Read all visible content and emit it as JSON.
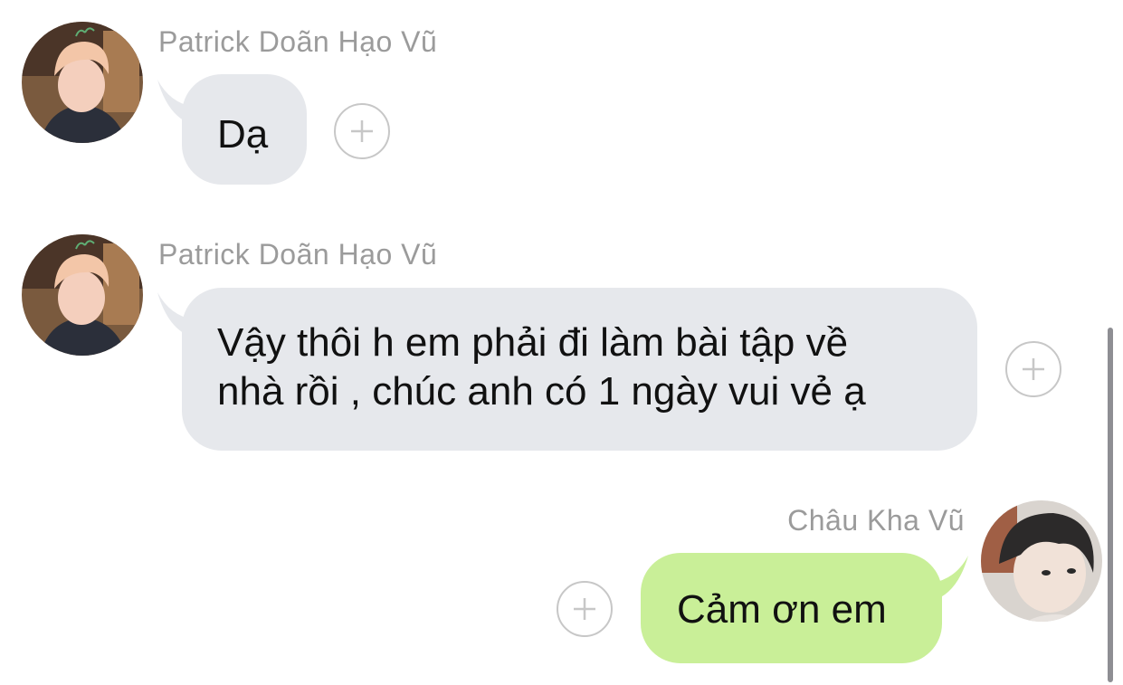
{
  "messages": [
    {
      "sender": "Patrick Doãn Hạo Vũ",
      "text": "Dạ",
      "direction": "incoming"
    },
    {
      "sender": "Patrick Doãn Hạo Vũ",
      "text_line1": "Vậy thôi h em phải đi làm bài tập về",
      "text_line2": "nhà rồi , chúc anh có 1 ngày vui vẻ ạ",
      "direction": "incoming"
    },
    {
      "sender": "Châu Kha Vũ",
      "text": "Cảm ơn em",
      "direction": "outgoing"
    }
  ],
  "colors": {
    "incoming_bubble": "#e6e8ec",
    "outgoing_bubble": "#c9ef98",
    "sender_name": "#9b9b9b",
    "react_button_border": "#c7c7c7"
  },
  "icons": {
    "react_button": "plus-circle-icon",
    "avatar": "user-avatar"
  }
}
